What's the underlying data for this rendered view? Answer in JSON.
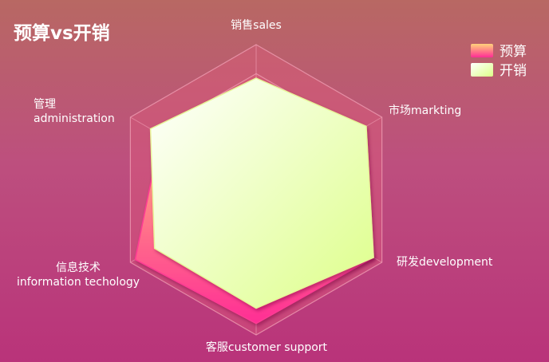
{
  "chart_data": {
    "type": "radar",
    "title": "预算vs开销",
    "indicators": [
      {
        "name": "销售sales",
        "max": 6500
      },
      {
        "name": "市场markting",
        "max": 16000
      },
      {
        "name": "研发development",
        "max": 30000
      },
      {
        "name": "客服customer support",
        "max": 38000
      },
      {
        "name": "信息技术\ninformation techology",
        "max": 52000
      },
      {
        "name": "管理\nadministration",
        "max": 25000
      }
    ],
    "series": [
      {
        "name": "预算",
        "values": [
          4300,
          10000,
          28000,
          35000,
          50000,
          19000
        ]
      },
      {
        "name": "开销",
        "values": [
          5000,
          14000,
          28000,
          31000,
          42000,
          21000
        ]
      }
    ],
    "split_number": 5,
    "legend_position": "top-right",
    "colors": {
      "预算_start": "#ffd27a",
      "预算_end": "#ff2d95",
      "开销_start": "#ffffff",
      "开销_end": "#ddff88",
      "radar_fill": "#e25b7b",
      "split_line": "#f2a0b6"
    }
  }
}
